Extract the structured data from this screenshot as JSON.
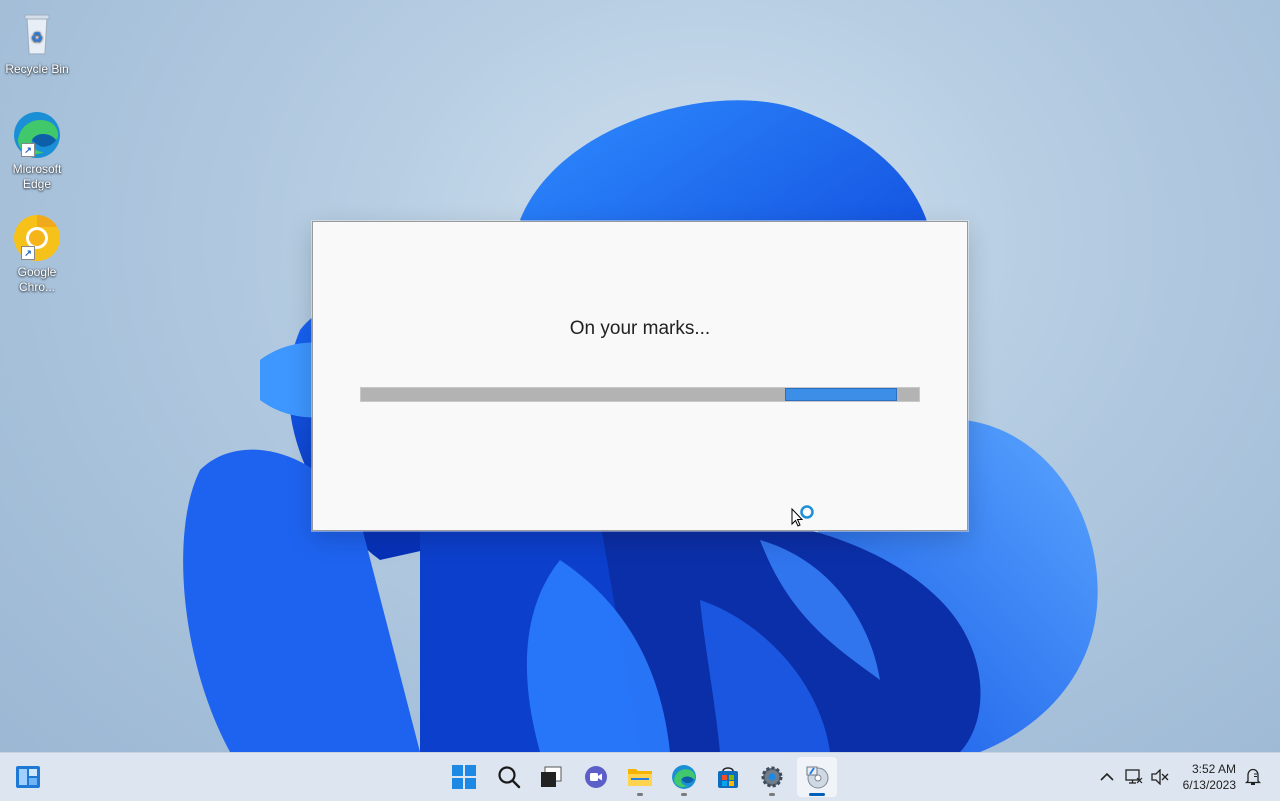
{
  "desktop": {
    "icons": [
      {
        "label": "Recycle Bin",
        "icon": "recycle-bin-icon"
      },
      {
        "label": "Microsoft Edge",
        "icon": "edge-icon"
      },
      {
        "label": "Google Chro...",
        "icon": "chrome-icon"
      }
    ]
  },
  "dialog": {
    "message": "On your marks...",
    "progress": {
      "type": "marquee",
      "segment_start": 0.76,
      "segment_end": 0.96
    }
  },
  "taskbar": {
    "left_widget": "widgets-icon",
    "apps": [
      {
        "name": "start-icon"
      },
      {
        "name": "search-icon"
      },
      {
        "name": "task-view-icon"
      },
      {
        "name": "chat-icon"
      },
      {
        "name": "file-explorer-icon",
        "running": true
      },
      {
        "name": "edge-icon",
        "running": true
      },
      {
        "name": "store-icon"
      },
      {
        "name": "settings-icon",
        "running": true
      },
      {
        "name": "installer-icon",
        "running": true,
        "active": true
      }
    ],
    "tray": {
      "icons": [
        "chevron-up-icon",
        "network-icon",
        "volume-muted-icon",
        "notification-icon"
      ],
      "time": "3:52 AM",
      "date": "6/13/2023"
    }
  },
  "colors": {
    "accent": "#005fb8",
    "progress_fill": "#3d8ee6",
    "progress_track": "#b3b3b3"
  }
}
